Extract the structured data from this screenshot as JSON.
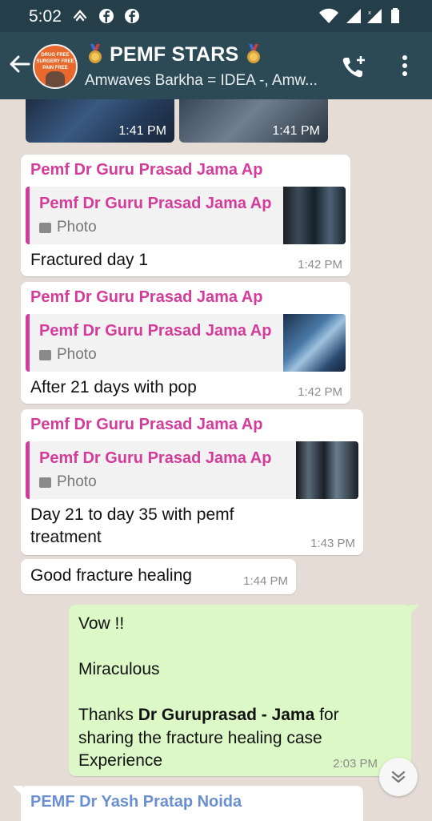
{
  "status_bar": {
    "time": "5:02",
    "icons": [
      "hotspot-icon",
      "facebook-icon",
      "facebook-icon",
      "wifi-icon",
      "signal-icon",
      "signal-icon",
      "battery-icon"
    ]
  },
  "header": {
    "group_name": "PEMF STARS",
    "title_emoji": "medal-icon",
    "participants": "Amwaves Barkha = IDEA -, Amw...",
    "avatar_text": [
      "DRUG FREE",
      "SURGERY FREE",
      "PAIN FREE"
    ]
  },
  "messages": [
    {
      "kind": "photos",
      "times": [
        "1:41 PM",
        "1:41 PM"
      ]
    },
    {
      "kind": "reply",
      "sender": "Pemf Dr Guru Prasad Jama Ap",
      "quote_sender": "Pemf Dr Guru Prasad Jama Ap",
      "quote_label": "Photo",
      "text": "Fractured day 1",
      "time": "1:42 PM"
    },
    {
      "kind": "reply",
      "sender": "Pemf Dr Guru Prasad Jama Ap",
      "quote_sender": "Pemf Dr Guru Prasad Jama Ap",
      "quote_label": "Photo",
      "text": "After 21 days with pop",
      "time": "1:42 PM"
    },
    {
      "kind": "reply",
      "sender": "Pemf Dr Guru Prasad Jama Ap",
      "quote_sender": "Pemf Dr Guru Prasad Jama Ap",
      "quote_label": "Photo",
      "text_line1": "Day 21 to day 35 with pemf",
      "text_line2": "treatment",
      "time": "1:43 PM"
    },
    {
      "kind": "text",
      "text": "Good fracture healing",
      "time": "1:44 PM"
    },
    {
      "kind": "outgoing",
      "line1": "Vow !!",
      "line2": "Miraculous",
      "thanks_pre": "Thanks ",
      "thanks_name": "Dr Guruprasad -  Jama",
      "thanks_post": " for",
      "line4": "sharing the fracture healing case",
      "line5": "Experience",
      "time": "2:03 PM"
    },
    {
      "kind": "partial",
      "sender": "PEMF Dr Yash Pratap Noida"
    }
  ],
  "colors": {
    "header": "#2b4a56",
    "status_bar": "#243f49",
    "chat_bg": "#e5ddd5",
    "incoming": "#ffffff",
    "outgoing": "#dcf8c6",
    "sender_pink": "#d43c9b",
    "sender_blue": "#6a8fd0"
  }
}
